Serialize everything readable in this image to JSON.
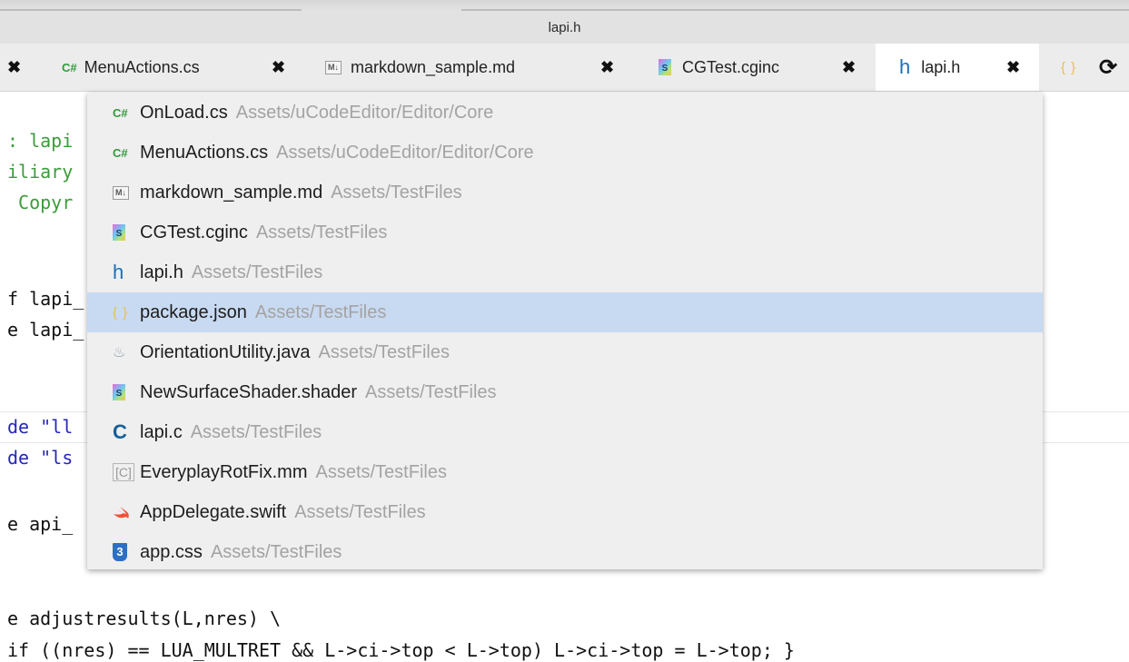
{
  "window": {
    "title": "lapi.h"
  },
  "tabs": [
    {
      "label": "MenuActions.cs",
      "icon": "csharp-icon",
      "icon_text": "C#"
    },
    {
      "label": "markdown_sample.md",
      "icon": "markdown-icon",
      "icon_text": "M↓"
    },
    {
      "label": "CGTest.cginc",
      "icon": "shader-icon",
      "icon_text": "S"
    },
    {
      "label": "lapi.h",
      "icon": "header-icon",
      "icon_text": "h",
      "active": true
    },
    {
      "label": "",
      "icon": "json-icon",
      "icon_text": "{ }"
    }
  ],
  "close_glyph": "✖",
  "refresh_glyph": "⟳",
  "editor": {
    "lines": [
      {
        "text": ": lapi"
      },
      {
        "text": "iliary"
      },
      {
        "text": " Copyr"
      },
      {
        "text": "f lapi_"
      },
      {
        "text": "e lapi_"
      },
      {
        "text": "de \"ll"
      },
      {
        "text": "de \"ls"
      },
      {
        "text": "e api_"
      },
      {
        "text": "e adjustresults(L,nres) \\"
      },
      {
        "text": "if ((nres) == LUA_MULTRET && L->ci->top < L->top) L->ci->top = L->top; }"
      }
    ]
  },
  "autocomplete": {
    "items": [
      {
        "name": "OnLoad.cs",
        "path": "Assets/uCodeEditor/Editor/Core",
        "icon": "csharp-icon",
        "icon_text": "C#"
      },
      {
        "name": "MenuActions.cs",
        "path": "Assets/uCodeEditor/Editor/Core",
        "icon": "csharp-icon",
        "icon_text": "C#"
      },
      {
        "name": "markdown_sample.md",
        "path": "Assets/TestFiles",
        "icon": "markdown-icon",
        "icon_text": "M↓"
      },
      {
        "name": "CGTest.cginc",
        "path": "Assets/TestFiles",
        "icon": "shader-icon",
        "icon_text": "S"
      },
      {
        "name": "lapi.h",
        "path": "Assets/TestFiles",
        "icon": "header-icon",
        "icon_text": "h"
      },
      {
        "name": "package.json",
        "path": "Assets/TestFiles",
        "icon": "json-icon",
        "icon_text": "{ }",
        "selected": true
      },
      {
        "name": "OrientationUtility.java",
        "path": "Assets/TestFiles",
        "icon": "java-icon",
        "icon_text": "♨"
      },
      {
        "name": "NewSurfaceShader.shader",
        "path": "Assets/TestFiles",
        "icon": "shader-icon",
        "icon_text": "S"
      },
      {
        "name": "lapi.c",
        "path": "Assets/TestFiles",
        "icon": "c-icon",
        "icon_text": "C"
      },
      {
        "name": "EveryplayRotFix.mm",
        "path": "Assets/TestFiles",
        "icon": "objc-icon",
        "icon_text": "[C]"
      },
      {
        "name": "AppDelegate.swift",
        "path": "Assets/TestFiles",
        "icon": "swift-icon",
        "icon_text": ""
      },
      {
        "name": "app.css",
        "path": "Assets/TestFiles",
        "icon": "css-icon",
        "icon_text": "3"
      }
    ]
  },
  "colors": {
    "selection": "#c8daf1",
    "comment_green": "#3c9b3c",
    "keyword_blue": "#2626b9",
    "csharp_green": "#2f9b3a",
    "header_blue": "#1e6fb6",
    "path_gray": "#a3a3a3"
  }
}
